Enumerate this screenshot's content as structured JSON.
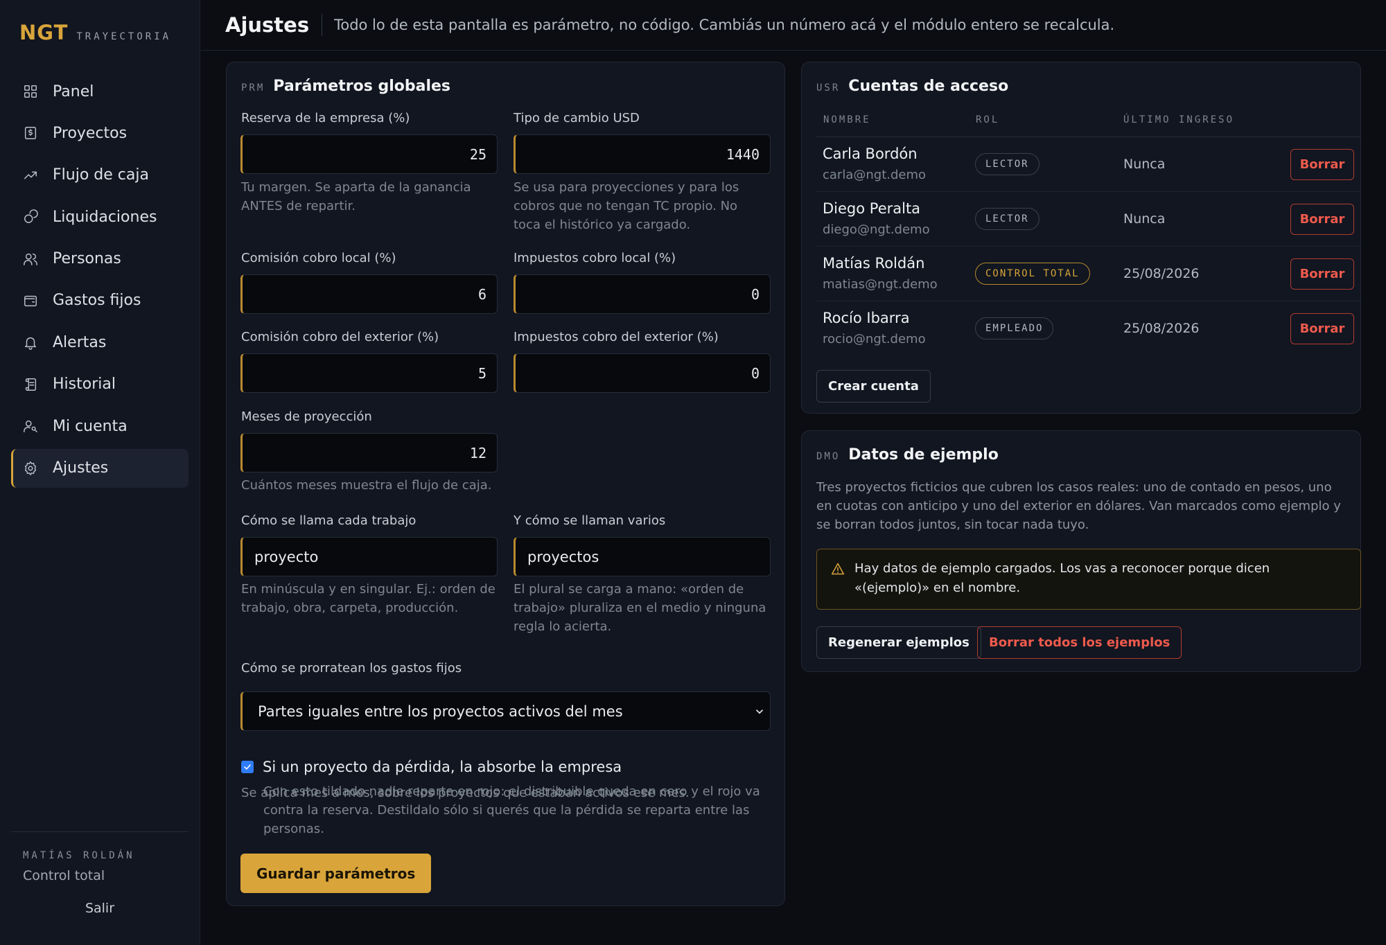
{
  "brand": {
    "logo": "NGT",
    "subtitle": "TRAYECTORIA"
  },
  "sidebar": {
    "items": [
      {
        "label": "Panel",
        "icon": "grid-icon"
      },
      {
        "label": "Proyectos",
        "icon": "file-dollar-icon"
      },
      {
        "label": "Flujo de caja",
        "icon": "trend-up-icon"
      },
      {
        "label": "Liquidaciones",
        "icon": "coins-icon"
      },
      {
        "label": "Personas",
        "icon": "users-icon"
      },
      {
        "label": "Gastos fijos",
        "icon": "wallet-icon"
      },
      {
        "label": "Alertas",
        "icon": "bell-icon"
      },
      {
        "label": "Historial",
        "icon": "scroll-icon"
      },
      {
        "label": "Mi cuenta",
        "icon": "user-key-icon"
      },
      {
        "label": "Ajustes",
        "icon": "gear-icon"
      }
    ],
    "active": "Ajustes",
    "user_name": "MATÍAS ROLDÁN",
    "user_role": "Control total",
    "logout": "Salir"
  },
  "header": {
    "title": "Ajustes",
    "subtitle": "Todo lo de esta pantalla es parámetro, no código. Cambiás un número acá y el módulo entero se recalcula."
  },
  "params": {
    "code": "PRM",
    "title": "Parámetros globales",
    "reserva": {
      "label": "Reserva de la empresa (%)",
      "value": "25",
      "help1": "Tu margen. Se aparta de la ganancia",
      "help2": "ANTES de repartir."
    },
    "tc": {
      "label": "Tipo de cambio USD",
      "value": "1440",
      "help1": "Se usa para proyecciones y para los",
      "help2": "cobros que no tengan TC propio. No",
      "help3": "toca el histórico ya cargado."
    },
    "com_local": {
      "label": "Comisión cobro local (%)",
      "value": "6"
    },
    "imp_local": {
      "label": "Impuestos cobro local (%)",
      "value": "0"
    },
    "com_ext": {
      "label": "Comisión cobro del exterior (%)",
      "value": "5"
    },
    "imp_ext": {
      "label": "Impuestos cobro del exterior (%)",
      "value": "0"
    },
    "meses": {
      "label": "Meses de proyección",
      "value": "12",
      "help": "Cuántos meses muestra el flujo de caja."
    },
    "singular": {
      "label": "Cómo se llama cada trabajo",
      "value": "proyecto",
      "help1": "En minúscula y en singular. Ej.: orden de",
      "help2": "trabajo, obra, carpeta, producción."
    },
    "plural": {
      "label": "Y cómo se llaman varios",
      "value": "proyectos",
      "help1": "El plural se carga a mano: «orden de",
      "help2": "trabajo» pluraliza en el medio y ninguna",
      "help3": "regla lo acierta."
    },
    "prorrateo": {
      "label": "Cómo se prorratean los gastos fijos",
      "selected": "Partes iguales entre los proyectos activos del mes",
      "help": "Se aplica mes a mes, sobre los proyectos que estaban activos ese mes."
    },
    "absorbe": {
      "label": "Si un proyecto da pérdida, la absorbe la empresa",
      "checked": true,
      "help1": "Con esto tildado nadie reparte en rojo: el distribuible queda en cero y el rojo va",
      "help2": "contra la reserva. Destildalo sólo si querés que la pérdida se reparta entre las",
      "help3": "personas."
    },
    "save": "Guardar parámetros"
  },
  "accounts": {
    "code": "USR",
    "title": "Cuentas de acceso",
    "columns": [
      "NOMBRE",
      "ROL",
      "ÚLTIMO INGRESO"
    ],
    "rows": [
      {
        "name": "Carla Bordón",
        "email": "carla@ngt.demo",
        "role": "LECTOR",
        "last": "Nunca",
        "action": "Borrar"
      },
      {
        "name": "Diego Peralta",
        "email": "diego@ngt.demo",
        "role": "LECTOR",
        "last": "Nunca",
        "action": "Borrar"
      },
      {
        "name": "Matías Roldán",
        "email": "matias@ngt.demo",
        "role": "CONTROL TOTAL",
        "last": "25/08/2026",
        "action": "Borrar"
      },
      {
        "name": "Rocío Ibarra",
        "email": "rocio@ngt.demo",
        "role": "EMPLEADO",
        "last": "25/08/2026",
        "action": "Borrar"
      }
    ],
    "create": "Crear cuenta"
  },
  "demo": {
    "code": "DMO",
    "title": "Datos de ejemplo",
    "desc1": "Tres proyectos ficticios que cubren los casos reales: uno de contado en pesos, uno",
    "desc2": "en cuotas con anticipo y uno del exterior en dólares. Van marcados como ejemplo y",
    "desc3": "se borran todos juntos, sin tocar nada tuyo.",
    "alert1": "Hay datos de ejemplo cargados. Los vas a reconocer porque dicen",
    "alert2": "«(ejemplo)» en el nombre.",
    "regen": "Regenerar ejemplos",
    "delete_all": "Borrar todos los ejemplos"
  },
  "colors": {
    "accent": "#d9a53a",
    "danger": "#ef5a4d",
    "check": "#2f7cf6"
  }
}
